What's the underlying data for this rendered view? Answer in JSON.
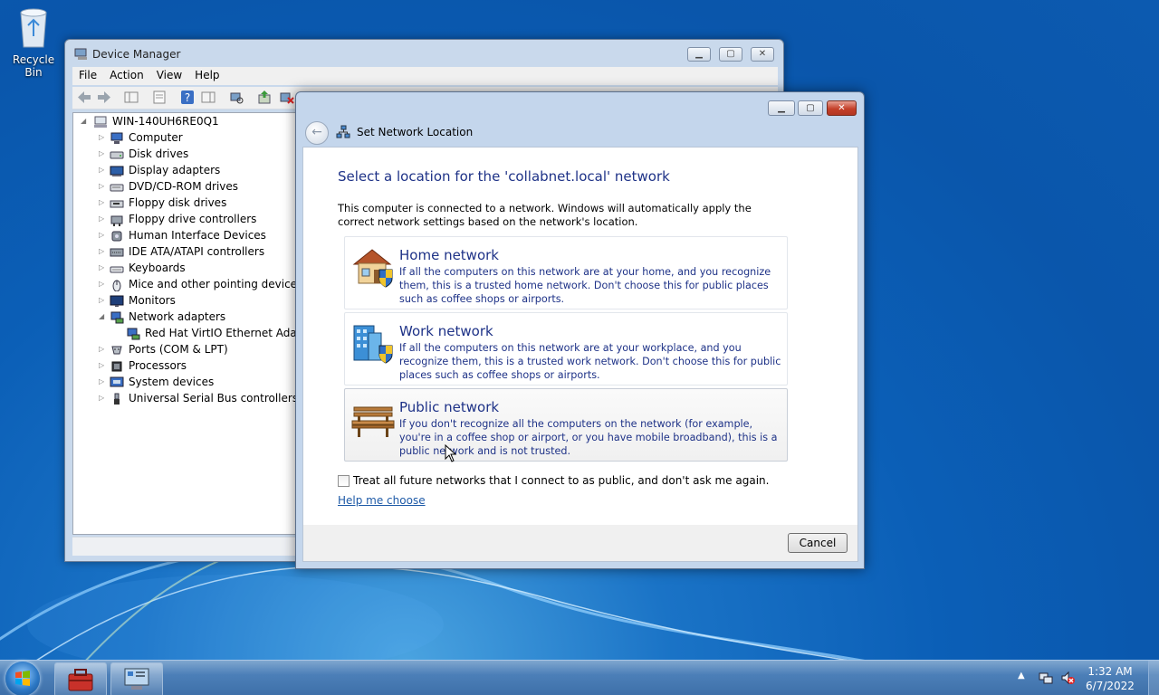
{
  "desktop": {
    "recycle_bin_label": "Recycle Bin"
  },
  "device_manager": {
    "title": "Device Manager",
    "menu": [
      "File",
      "Action",
      "View",
      "Help"
    ],
    "tree": {
      "root": "WIN-140UH6RE0Q1",
      "items": [
        {
          "label": "Computer",
          "icon": "computer-icon",
          "expanded": false
        },
        {
          "label": "Disk drives",
          "icon": "disk-drive-icon",
          "expanded": false
        },
        {
          "label": "Display adapters",
          "icon": "display-adapter-icon",
          "expanded": false
        },
        {
          "label": "DVD/CD-ROM drives",
          "icon": "dvd-drive-icon",
          "expanded": false
        },
        {
          "label": "Floppy disk drives",
          "icon": "floppy-icon",
          "expanded": false
        },
        {
          "label": "Floppy drive controllers",
          "icon": "controller-icon",
          "expanded": false
        },
        {
          "label": "Human Interface Devices",
          "icon": "hid-icon",
          "expanded": false
        },
        {
          "label": "IDE ATA/ATAPI controllers",
          "icon": "ide-icon",
          "expanded": false
        },
        {
          "label": "Keyboards",
          "icon": "keyboard-icon",
          "expanded": false
        },
        {
          "label": "Mice and other pointing devices",
          "icon": "mouse-icon",
          "expanded": false
        },
        {
          "label": "Monitors",
          "icon": "monitor-icon",
          "expanded": false
        },
        {
          "label": "Network adapters",
          "icon": "network-adapter-icon",
          "expanded": true
        },
        {
          "label": "Red Hat VirtIO Ethernet Adapter",
          "icon": "network-card-icon",
          "child": true
        },
        {
          "label": "Ports (COM & LPT)",
          "icon": "port-icon",
          "expanded": false
        },
        {
          "label": "Processors",
          "icon": "processor-icon",
          "expanded": false
        },
        {
          "label": "System devices",
          "icon": "system-device-icon",
          "expanded": false
        },
        {
          "label": "Universal Serial Bus controllers",
          "icon": "usb-icon",
          "expanded": false
        }
      ]
    }
  },
  "dialog": {
    "title": "Set Network Location",
    "heading": "Select a location for the 'collabnet.local' network",
    "intro": "This computer is connected to a network. Windows will automatically apply the correct network settings based on the network's location.",
    "options": [
      {
        "title": "Home network",
        "description": "If all the computers on this network are at your home, and you recognize them, this is a trusted home network.  Don't choose this for public places such as coffee shops or airports.",
        "icon": "house-icon"
      },
      {
        "title": "Work network",
        "description": "If all the computers on this network are at your workplace, and you recognize them, this is a trusted work network.  Don't choose this for public places such as coffee shops or airports.",
        "icon": "office-building-icon"
      },
      {
        "title": "Public network",
        "description": "If you don't recognize all the computers on the network (for example, you're in a coffee shop or airport, or you have mobile broadband), this is a public network and is not trusted.",
        "icon": "park-bench-icon"
      }
    ],
    "checkbox_label": "Treat all future networks that I connect to as public, and don't ask me again.",
    "checkbox_checked": false,
    "help_link": "Help me choose",
    "cancel_label": "Cancel"
  },
  "taskbar": {
    "clock_time": "1:32 AM",
    "clock_date": "6/7/2022"
  },
  "colors": {
    "heading_blue": "#1e3287",
    "link_blue": "#1e5aa7",
    "desktop_blue": "#0b5fb7"
  }
}
